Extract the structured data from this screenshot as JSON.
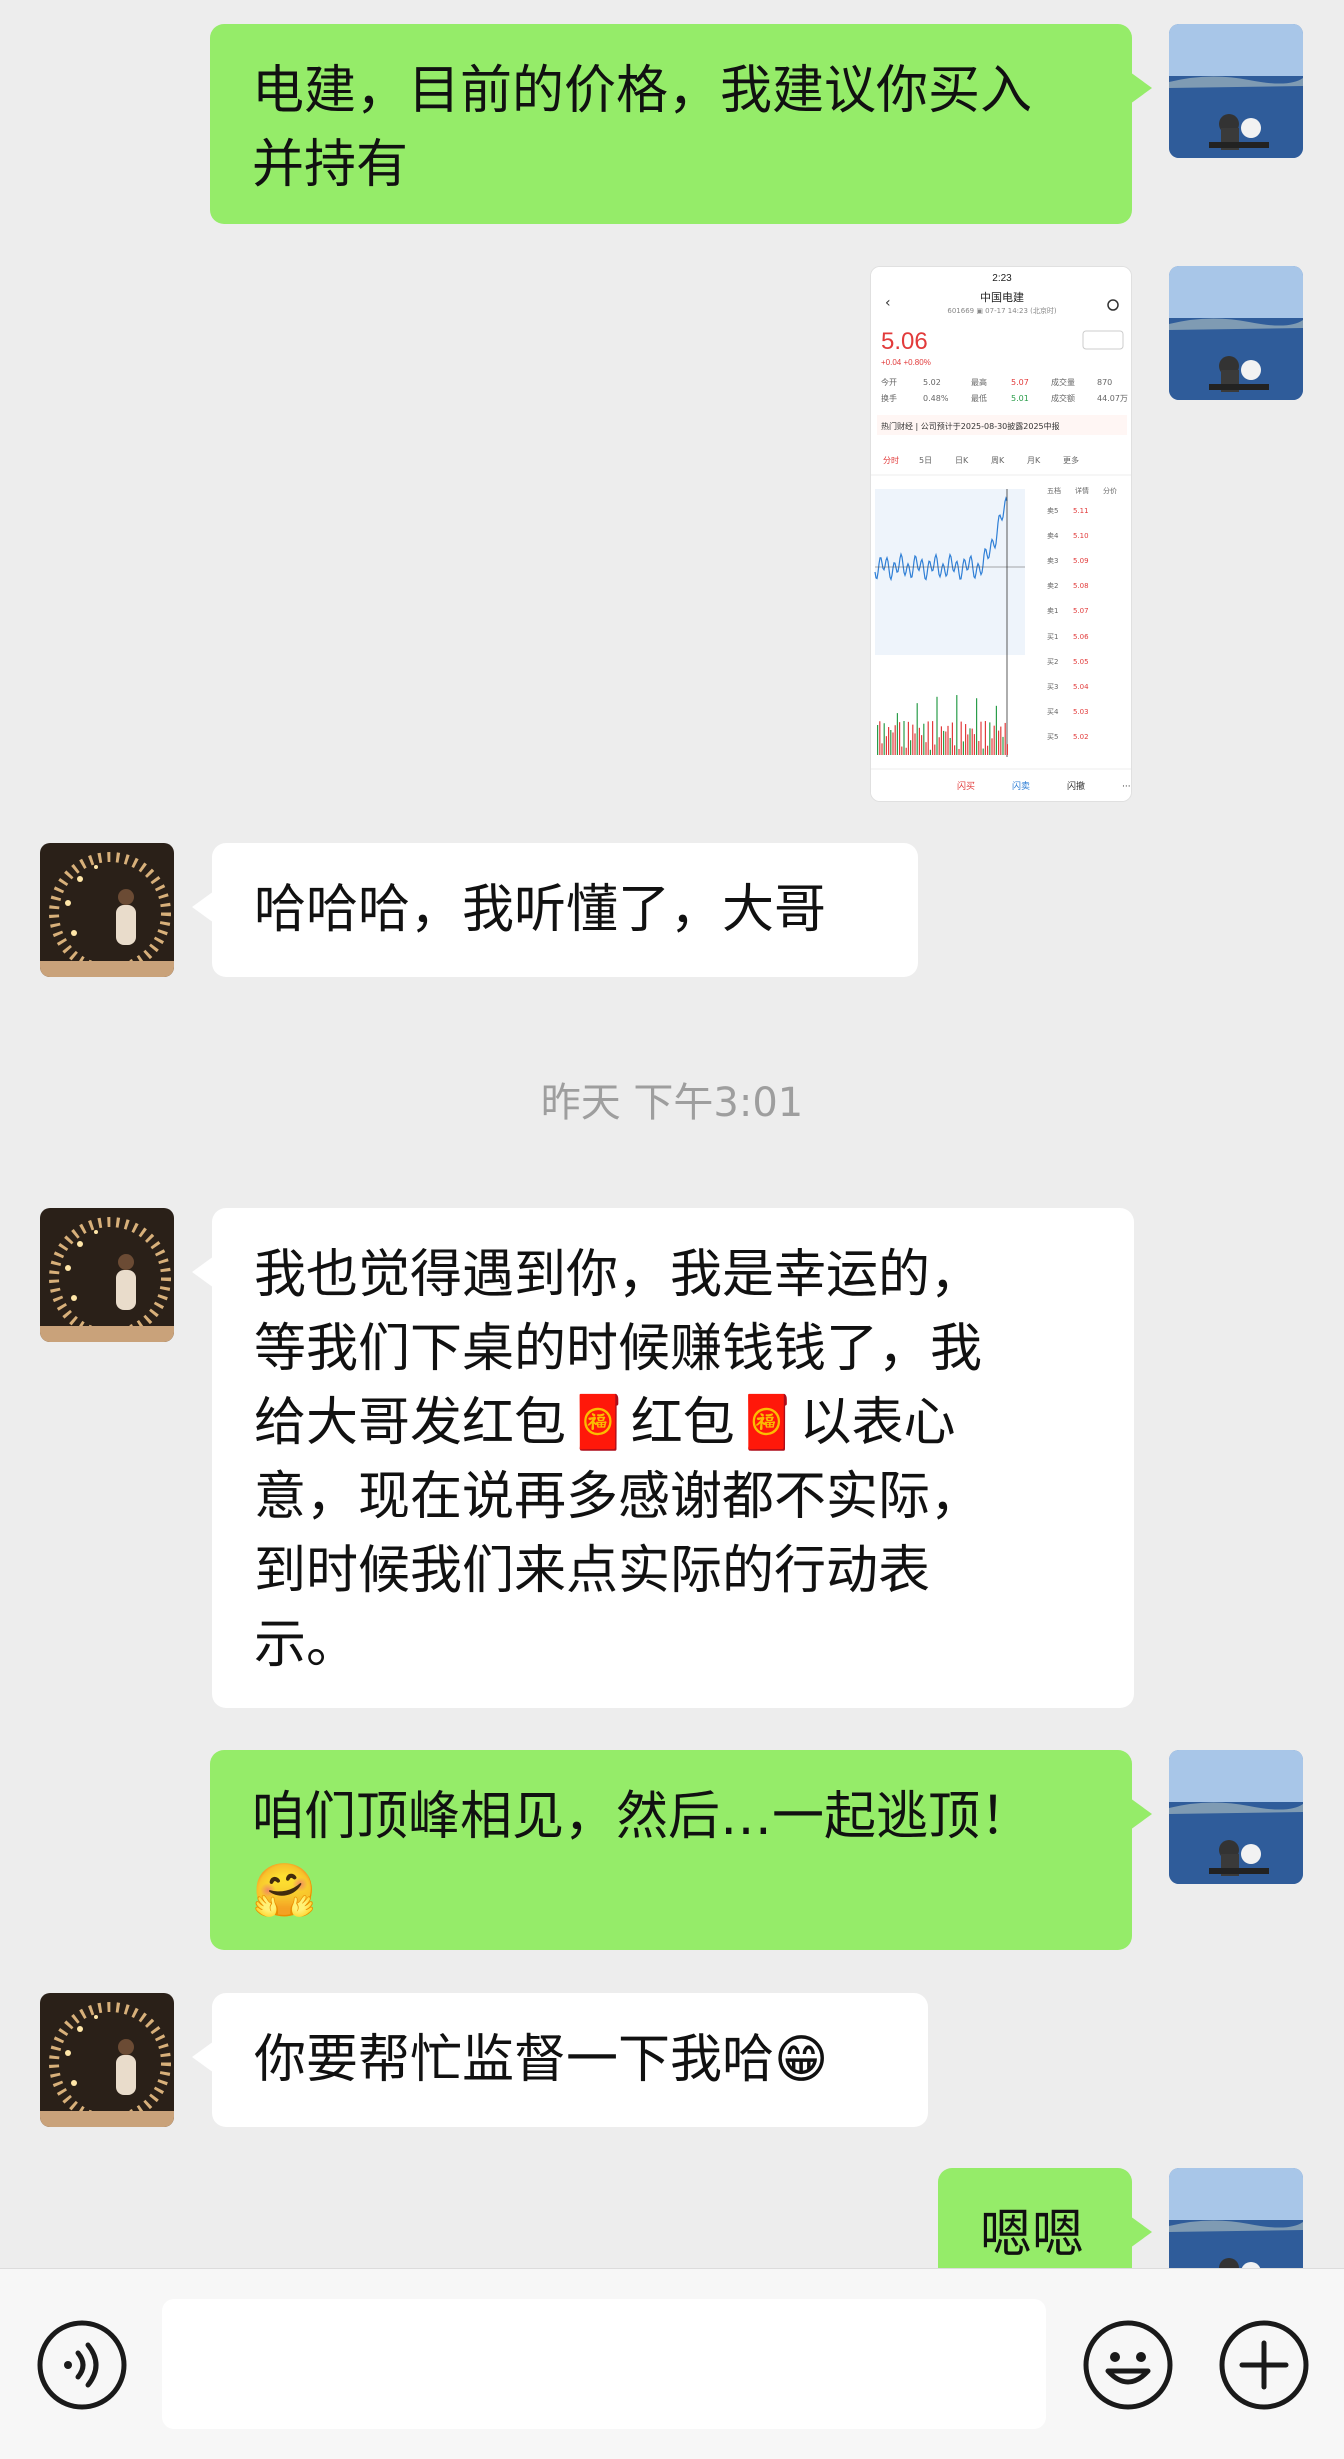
{
  "messages": [
    {
      "sender": "me",
      "lines": [
        "电建，目前的价格，我建议你买入",
        "并持有"
      ]
    },
    {
      "sender": "me",
      "type": "image",
      "image": {
        "time": "2:23",
        "stock_name": "中国电建",
        "stock_sub": "601669 ▣ 07-17 14:23 (北京时)",
        "price": "5.06",
        "change": "+0.04 +0.80%",
        "stats_row1": [
          "今开",
          "5.02",
          "最高",
          "5.07",
          "成交量",
          "870"
        ],
        "stats_row2": [
          "换手",
          "0.48%",
          "最低",
          "5.01",
          "成交额",
          "44.07万"
        ],
        "news": "热门财经 | 公司预计于2025-08-30披露2025中报",
        "tabs": [
          "分时",
          "5日",
          "日K",
          "周K",
          "月K",
          "更多"
        ],
        "book_header": [
          "五档",
          "详情",
          "分价"
        ],
        "asks": [
          [
            "卖5",
            "5.11"
          ],
          [
            "卖4",
            "5.10"
          ],
          [
            "卖3",
            "5.09"
          ],
          [
            "卖2",
            "5.08"
          ],
          [
            "卖1",
            "5.07"
          ]
        ],
        "bids": [
          [
            "买1",
            "5.06"
          ],
          [
            "买2",
            "5.05"
          ],
          [
            "买3",
            "5.04"
          ],
          [
            "买4",
            "5.03"
          ],
          [
            "买5",
            "5.02"
          ]
        ],
        "bottom": [
          "闪买",
          "闪卖",
          "闪撤",
          "···"
        ]
      }
    },
    {
      "sender": "other",
      "lines": [
        "哈哈哈，我听懂了，大哥"
      ]
    },
    {
      "sender": "other",
      "lines": [
        "我也觉得遇到你，我是幸运的，",
        "等我们下桌的时候赚钱钱了，我",
        "给大哥发红包🧧红包🧧以表心",
        "意，现在说再多感谢都不实际，",
        "到时候我们来点实际的行动表",
        "示。"
      ]
    },
    {
      "sender": "me",
      "lines": [
        "咱们顶峰相见，然后…一起逃顶！",
        "🤗"
      ]
    },
    {
      "sender": "other",
      "lines": [
        "你要帮忙监督一下我哈😁"
      ]
    },
    {
      "sender": "me",
      "lines": [
        "嗯嗯"
      ]
    }
  ],
  "timestamp": "昨天 下午3:01",
  "composer": {
    "voice_icon": "voice-icon",
    "emoji_icon": "emoji-icon",
    "plus_icon": "plus-icon"
  },
  "colors": {
    "me_bubble": "#95ec69",
    "other_bubble": "#ffffff",
    "background": "#ededed"
  }
}
